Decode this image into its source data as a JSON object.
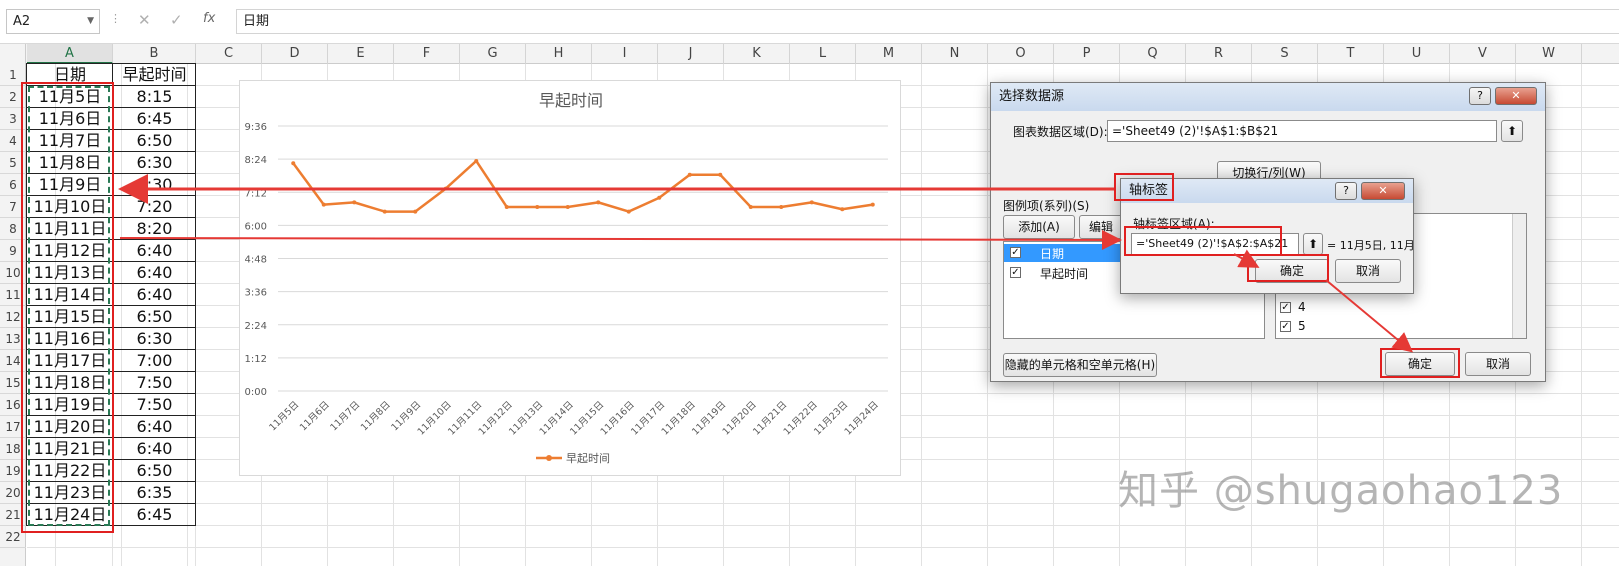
{
  "formula_bar": {
    "name_box": "A2",
    "fx_label": "fx",
    "formula": "日期"
  },
  "columns": [
    "A",
    "B",
    "C",
    "D",
    "E",
    "F",
    "G",
    "H",
    "I",
    "J",
    "K",
    "L",
    "M",
    "N",
    "O",
    "P",
    "Q",
    "R",
    "S",
    "T",
    "U",
    "V",
    "W"
  ],
  "rows": [
    "1",
    "2",
    "3",
    "4",
    "5",
    "6",
    "7",
    "8",
    "9",
    "10",
    "11",
    "12",
    "13",
    "14",
    "15",
    "16",
    "17",
    "18",
    "19",
    "20",
    "21",
    "22"
  ],
  "table": {
    "header_a": "日期",
    "header_b": "早起时间",
    "dates": [
      "11月5日",
      "11月6日",
      "11月7日",
      "11月8日",
      "11月9日",
      "11月10日",
      "11月11日",
      "11月12日",
      "11月13日",
      "11月14日",
      "11月15日",
      "11月16日",
      "11月17日",
      "11月18日",
      "11月19日",
      "11月20日",
      "11月21日",
      "11月22日",
      "11月23日",
      "11月24日"
    ],
    "times": [
      "8:15",
      "6:45",
      "6:50",
      "6:30",
      "6:30",
      "7:20",
      "8:20",
      "6:40",
      "6:40",
      "6:40",
      "6:50",
      "6:30",
      "7:00",
      "7:50",
      "7:50",
      "6:40",
      "6:40",
      "6:50",
      "6:35",
      "6:45"
    ]
  },
  "chart_data": {
    "type": "line",
    "title": "早起时间",
    "categories": [
      "11月5日",
      "11月6日",
      "11月7日",
      "11月8日",
      "11月9日",
      "11月10日",
      "11月11日",
      "11月12日",
      "11月13日",
      "11月14日",
      "11月15日",
      "11月16日",
      "11月17日",
      "11月18日",
      "11月19日",
      "11月20日",
      "11月21日",
      "11月22日",
      "11月23日",
      "11月24日"
    ],
    "series": [
      {
        "name": "早起时间",
        "values": [
          "8:15",
          "6:45",
          "6:50",
          "6:30",
          "6:30",
          "7:20",
          "8:20",
          "6:40",
          "6:40",
          "6:40",
          "6:50",
          "6:30",
          "7:00",
          "7:50",
          "7:50",
          "6:40",
          "6:40",
          "6:50",
          "6:35",
          "6:45"
        ],
        "color": "#ed7d31"
      }
    ],
    "y_ticks": [
      "0:00",
      "1:12",
      "2:24",
      "3:36",
      "4:48",
      "6:00",
      "7:12",
      "8:24",
      "9:36"
    ],
    "ylim": [
      "0:00",
      "9:36"
    ],
    "grid": true,
    "legend": "bottom"
  },
  "dialog_main": {
    "title": "选择数据源",
    "help": "?",
    "close": "✕",
    "range_label": "图表数据区域(D):",
    "range_value": "='Sheet49 (2)'!$A$1:$B$21",
    "switch_button": "切换行/列(W)",
    "series_label": "图例项(系列)(S)",
    "add_button": "添加(A)",
    "edit_button": "编辑",
    "series": [
      {
        "name": "日期",
        "checked": true
      },
      {
        "name": "早起时间",
        "checked": true
      }
    ],
    "axis_items": [
      "4",
      "5"
    ],
    "hidden_cells_button": "隐藏的单元格和空单元格(H)",
    "ok": "确定",
    "cancel": "取消"
  },
  "dialog_axis": {
    "title": "轴标签",
    "help": "?",
    "close": "✕",
    "range_label": "轴标签区域(A):",
    "range_value": "='Sheet49 (2)'!$A$2:$A$21",
    "preview": "= 11月5日, 11月",
    "ok": "确定",
    "cancel": "取消"
  },
  "watermark": "知乎 @shugaohao123",
  "colors": {
    "accent": "#217346",
    "highlight": "#e02020",
    "series": "#ed7d31",
    "selected_row": "#3399ff"
  }
}
